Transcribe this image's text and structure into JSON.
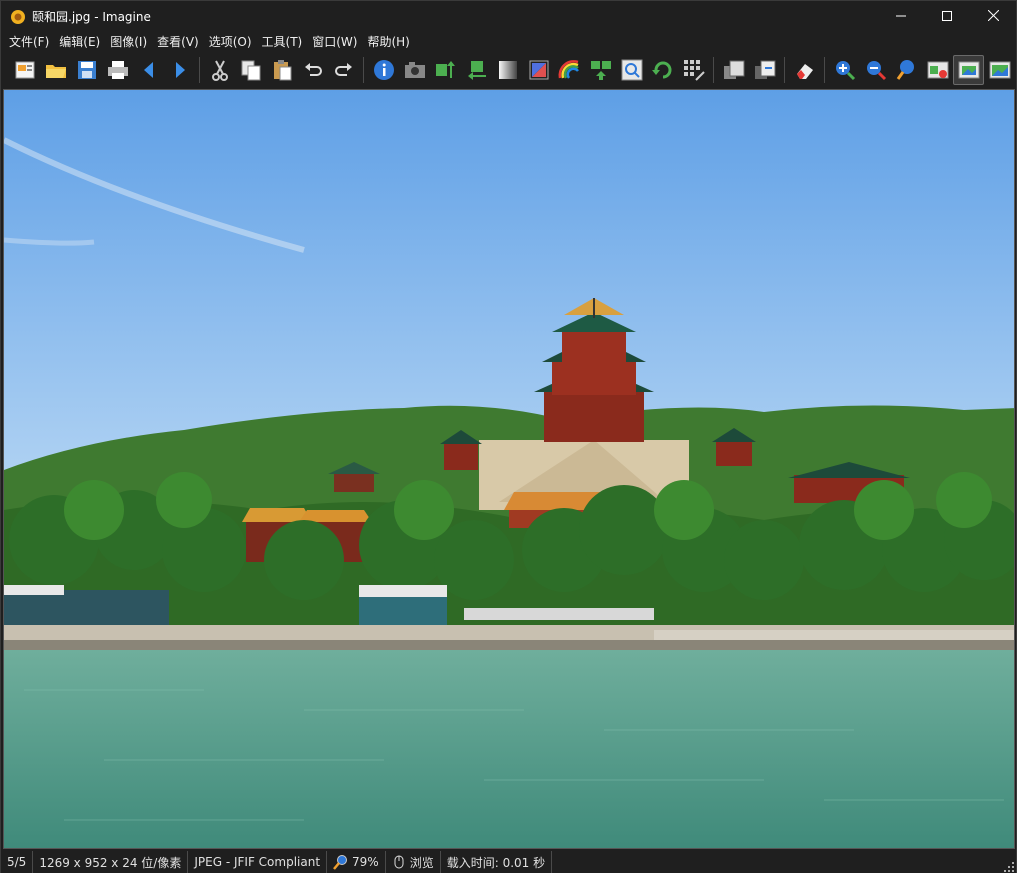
{
  "window": {
    "title": "颐和园.jpg - Imagine",
    "controls": {
      "minimize": "minimize-icon",
      "maximize": "maximize-icon",
      "close": "close-icon"
    }
  },
  "menu": [
    {
      "label": "文件(F)"
    },
    {
      "label": "编辑(E)"
    },
    {
      "label": "图像(I)"
    },
    {
      "label": "查看(V)"
    },
    {
      "label": "选项(O)"
    },
    {
      "label": "工具(T)"
    },
    {
      "label": "窗口(W)"
    },
    {
      "label": "帮助(H)"
    }
  ],
  "toolbar": [
    "browse-icon",
    "open-folder-icon",
    "save-icon",
    "print-icon",
    "previous-icon",
    "next-icon",
    "cut-icon",
    "copy-icon",
    "paste-icon",
    "undo-icon",
    "redo-icon",
    "info-icon",
    "capture-icon",
    "resize-icon",
    "crop-icon",
    "grayscale-icon",
    "enhance-icon",
    "effects-icon",
    "flip-icon",
    "zoom-box-icon",
    "rotate-icon",
    "grid-icon",
    "copy-to-icon",
    "move-to-icon",
    "eraser-icon",
    "zoom-in-icon",
    "zoom-out-icon",
    "zoom-reset-icon",
    "fit-width-icon",
    "fit-window-icon",
    "fullscreen-icon"
  ],
  "image": {
    "subject": "Summer Palace photo",
    "sky": "#6aa8e8",
    "water": "#5a9c8a"
  },
  "status": {
    "index": "5/5",
    "dimensions": "1269 x 952 x 24 位/像素",
    "format": "JPEG - JFIF Compliant",
    "zoom": "79%",
    "mode": "浏览",
    "load_time": "载入时间: 0.01 秒"
  }
}
